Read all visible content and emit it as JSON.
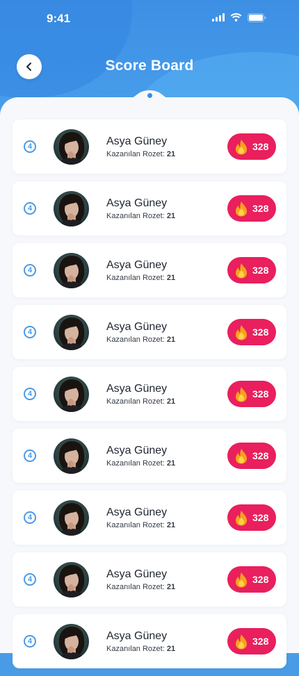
{
  "status_bar": {
    "time": "9:41"
  },
  "header": {
    "title": "Score Board"
  },
  "badge_label": "Kazanılan Rozet: ",
  "rows": [
    {
      "rank": "4",
      "name": "Asya Güney",
      "badges": "21",
      "score": "328"
    },
    {
      "rank": "4",
      "name": "Asya Güney",
      "badges": "21",
      "score": "328"
    },
    {
      "rank": "4",
      "name": "Asya Güney",
      "badges": "21",
      "score": "328"
    },
    {
      "rank": "4",
      "name": "Asya Güney",
      "badges": "21",
      "score": "328"
    },
    {
      "rank": "4",
      "name": "Asya Güney",
      "badges": "21",
      "score": "328"
    },
    {
      "rank": "4",
      "name": "Asya Güney",
      "badges": "21",
      "score": "328"
    },
    {
      "rank": "4",
      "name": "Asya Güney",
      "badges": "21",
      "score": "328"
    },
    {
      "rank": "4",
      "name": "Asya Güney",
      "badges": "21",
      "score": "328"
    },
    {
      "rank": "4",
      "name": "Asya Güney",
      "badges": "21",
      "score": "328"
    }
  ],
  "icons": {
    "back": "chevron-left-icon",
    "signal": "cellular-signal-icon",
    "wifi": "wifi-icon",
    "battery": "battery-icon",
    "score": "flame-icon"
  },
  "colors": {
    "primary_blue": "#3d8fe4",
    "score_pill": "#e91f5e",
    "flame": "#f7a21b"
  }
}
